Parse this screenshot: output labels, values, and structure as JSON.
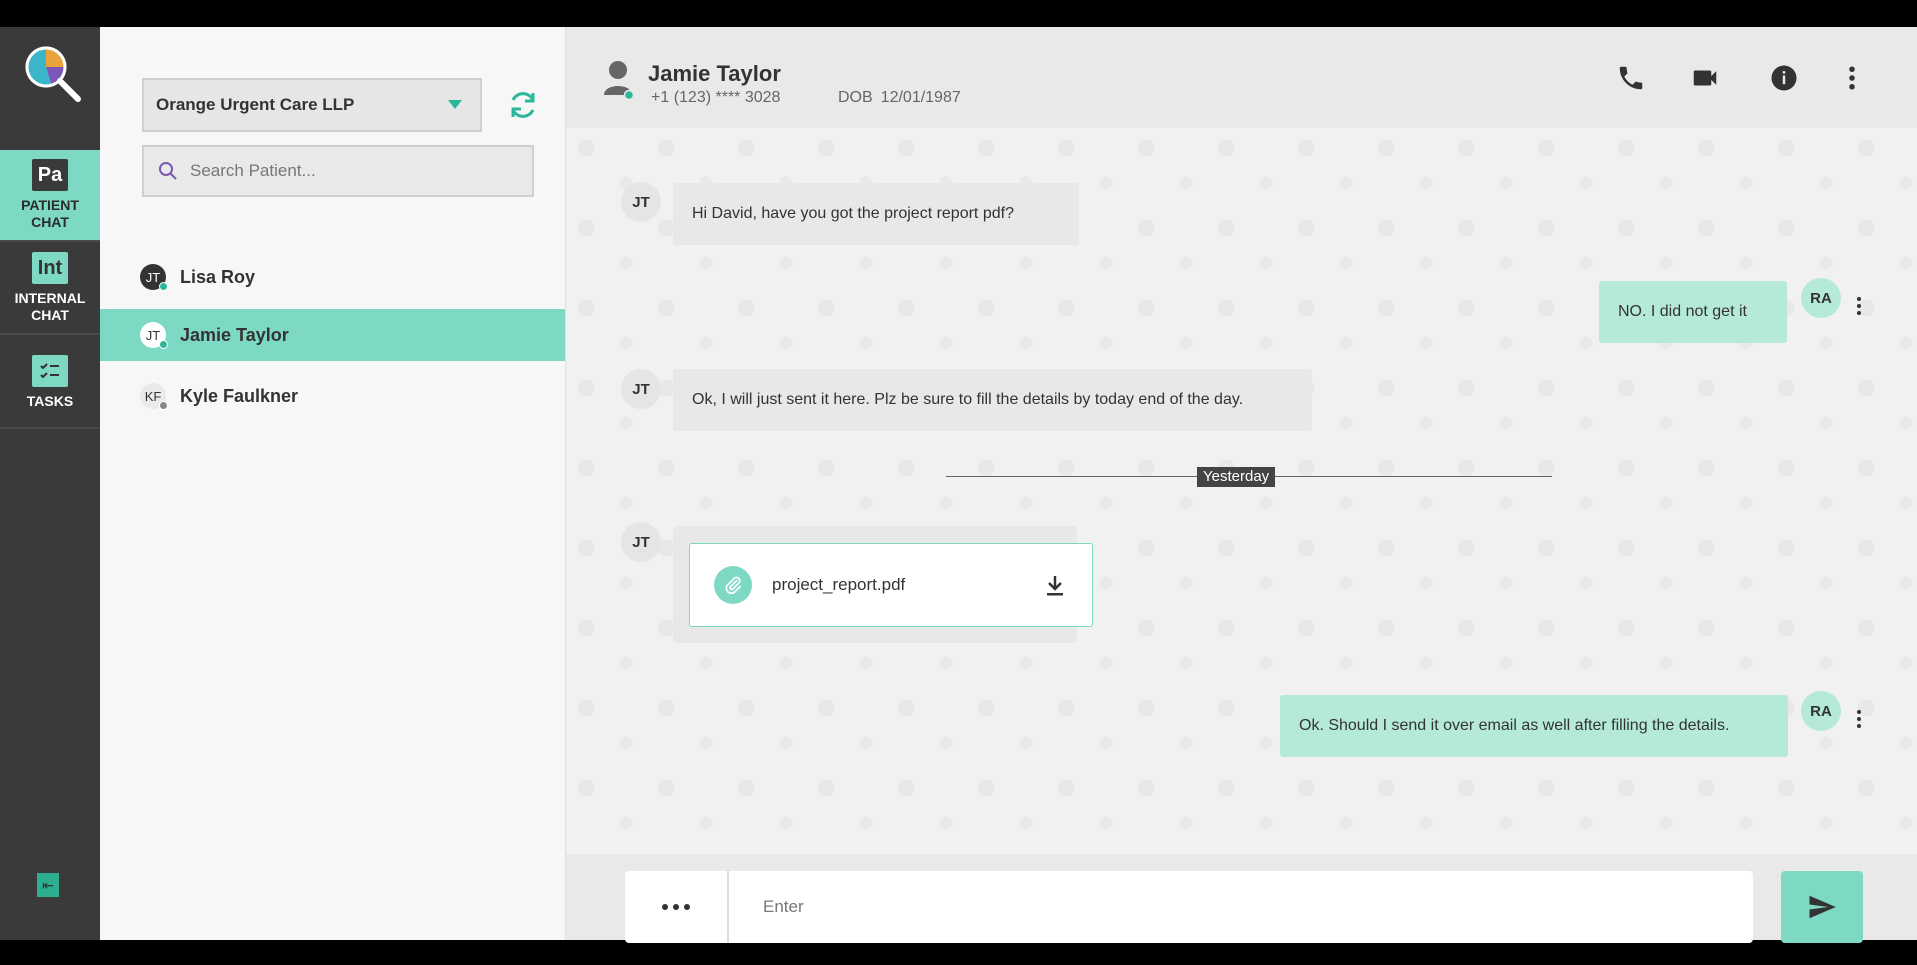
{
  "nav": {
    "items": [
      {
        "icon": "Pa",
        "label_line1": "PATIENT",
        "label_line2": "CHAT"
      },
      {
        "icon": "Int",
        "label_line1": "INTERNAL",
        "label_line2": "CHAT"
      },
      {
        "icon": "tasks-icon",
        "label_line1": "TASKS",
        "label_line2": ""
      }
    ],
    "active": "PATIENT CHAT"
  },
  "org_select": {
    "value": "Orange Urgent Care LLP"
  },
  "search": {
    "placeholder": "Search Patient..."
  },
  "patients": [
    {
      "initials": "JT",
      "name": "Lisa Roy",
      "status": "online"
    },
    {
      "initials": "JT",
      "name": "Jamie Taylor",
      "status": "online",
      "selected": true
    },
    {
      "initials": "KF",
      "name": "Kyle Faulkner",
      "status": "offline"
    }
  ],
  "chat_header": {
    "name": "Jamie Taylor",
    "phone": "+1 (123) **** 3028",
    "dob_label": "DOB",
    "dob_value": "12/01/1987"
  },
  "messages": [
    {
      "from": "JT",
      "direction": "in",
      "text": "Hi David, have you got the project report pdf?"
    },
    {
      "from": "RA",
      "direction": "out",
      "text": "NO. I did not get it"
    },
    {
      "from": "JT",
      "direction": "in",
      "text": "Ok, I will just sent it here. Plz be sure to fill the details by today end of the day."
    },
    {
      "divider": "Yesterday"
    },
    {
      "from": "JT",
      "direction": "in",
      "file": "project_report.pdf"
    },
    {
      "from": "RA",
      "direction": "out",
      "text": "Ok. Should I send it over email as well after filling the details."
    }
  ],
  "composer": {
    "placeholder": "Enter"
  },
  "colors": {
    "accent": "#7dd9c3",
    "rail": "#3a3a3a",
    "online": "#2cb79a",
    "outgoing_bubble": "#b5ead9"
  }
}
